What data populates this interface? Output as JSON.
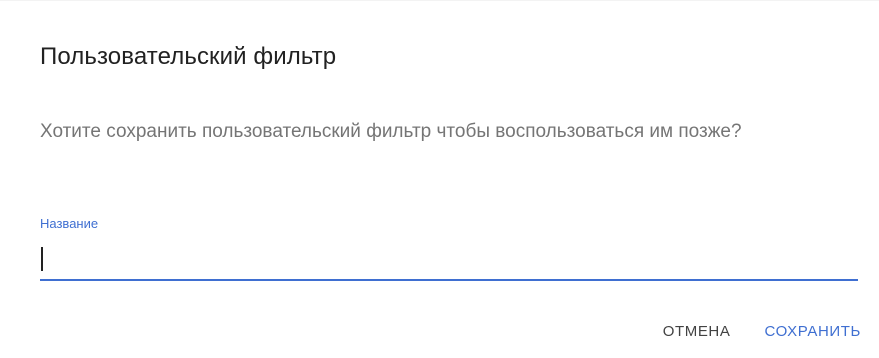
{
  "dialog": {
    "title": "Пользовательский фильтр",
    "message": "Хотите сохранить пользовательский фильтр чтобы воспользоваться им позже?",
    "name_field": {
      "label": "Название",
      "value": ""
    },
    "actions": {
      "cancel_label": "ОТМЕНА",
      "save_label": "СОХРАНИТЬ"
    }
  },
  "colors": {
    "accent": "#3f6fd1",
    "title_text": "#212121",
    "secondary_text": "#757575",
    "cancel_text": "#424242"
  }
}
